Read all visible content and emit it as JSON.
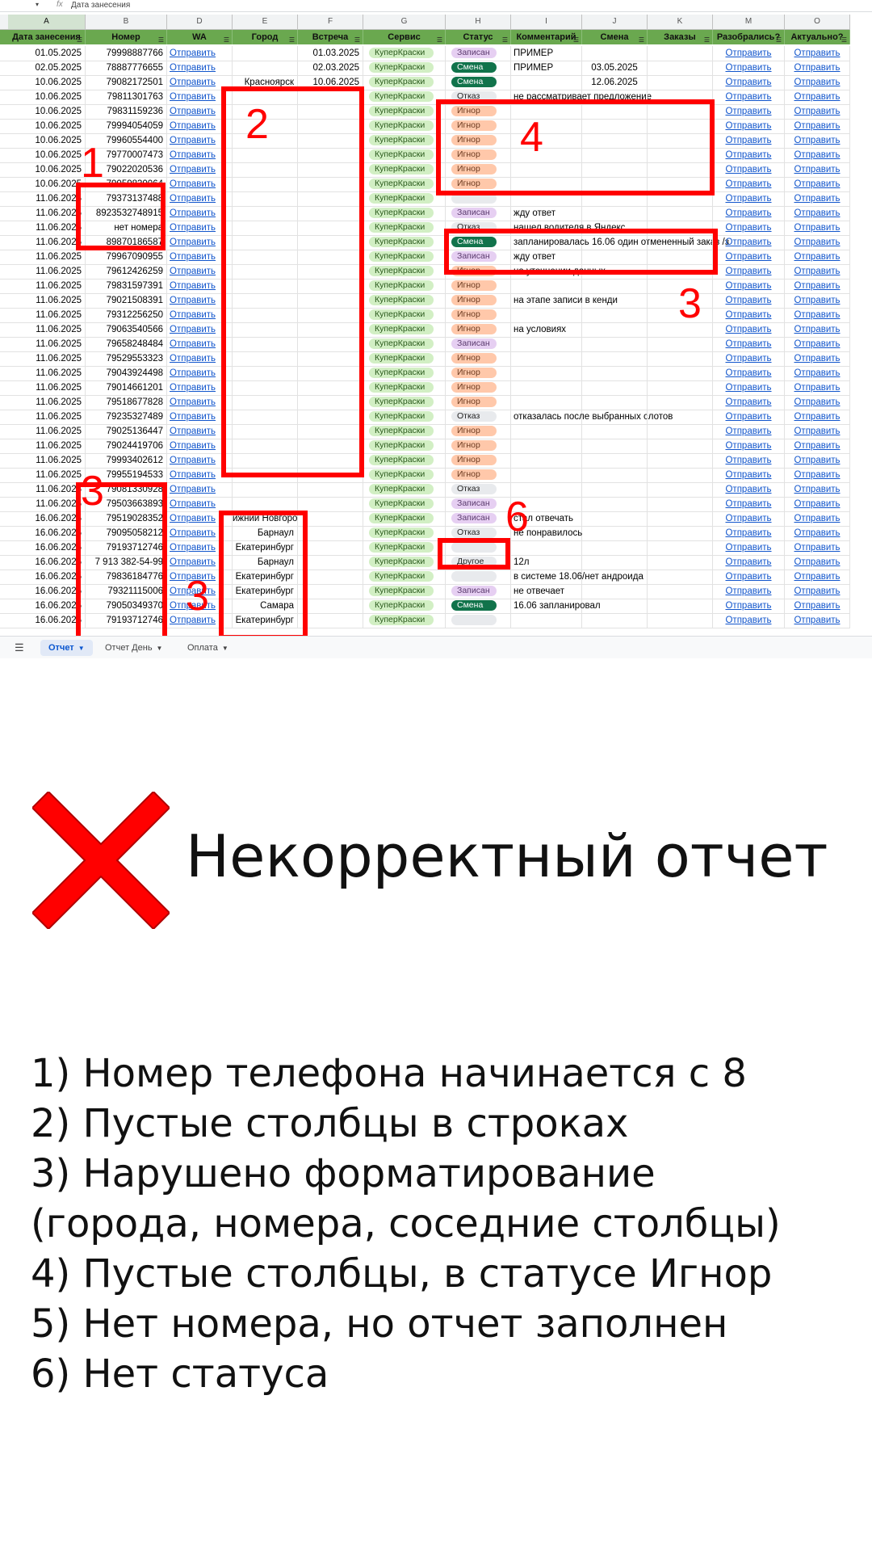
{
  "formula_bar": {
    "value": "Дата занесения"
  },
  "columns": [
    {
      "letter": "A",
      "header": "Дата занесения",
      "w": 96
    },
    {
      "letter": "B",
      "header": "Номер",
      "w": 101
    },
    {
      "letter": "D",
      "header": "WA",
      "w": 81
    },
    {
      "letter": "E",
      "header": "Город",
      "w": 81
    },
    {
      "letter": "F",
      "header": "Встреча",
      "w": 81
    },
    {
      "letter": "G",
      "header": "Сервис",
      "w": 102
    },
    {
      "letter": "H",
      "header": "Статус",
      "w": 81
    },
    {
      "letter": "I",
      "header": "Комментарий",
      "w": 88
    },
    {
      "letter": "J",
      "header": "Смена",
      "w": 81
    },
    {
      "letter": "K",
      "header": "Заказы",
      "w": 81
    },
    {
      "letter": "M",
      "header": "Разобрались?",
      "w": 89
    },
    {
      "letter": "O",
      "header": "Актуально?",
      "w": 81
    }
  ],
  "send_label": "Отправить",
  "rows": [
    {
      "date": "01.05.2025",
      "num": "79998887766",
      "city": "",
      "meet": "01.03.2025",
      "svc": "КуперКраски",
      "status": "Записан",
      "comment": "ПРИМЕР",
      "shift": ""
    },
    {
      "date": "02.05.2025",
      "num": "78887776655",
      "city": "",
      "meet": "02.03.2025",
      "svc": "КуперКраски",
      "status": "Смена",
      "comment": "ПРИМЕР",
      "shift": "03.05.2025"
    },
    {
      "date": "10.06.2025",
      "num": "79082172501",
      "city": "Красноярск",
      "meet": "10.06.2025",
      "svc": "КуперКраски",
      "status": "Смена",
      "comment": "",
      "shift": "12.06.2025"
    },
    {
      "date": "10.06.2025",
      "num": "79811301763",
      "city": "",
      "meet": "",
      "svc": "КуперКраски",
      "status": "Отказ",
      "comment": "не рассматривает предложение",
      "shift": ""
    },
    {
      "date": "10.06.2025",
      "num": "79831159236",
      "city": "",
      "meet": "",
      "svc": "КуперКраски",
      "status": "Игнор",
      "comment": "",
      "shift": ""
    },
    {
      "date": "10.06.2025",
      "num": "79994054059",
      "city": "",
      "meet": "",
      "svc": "КуперКраски",
      "status": "Игнор",
      "comment": "",
      "shift": ""
    },
    {
      "date": "10.06.2025",
      "num": "79960554400",
      "city": "",
      "meet": "",
      "svc": "КуперКраски",
      "status": "Игнор",
      "comment": "",
      "shift": ""
    },
    {
      "date": "10.06.2025",
      "num": "79770007473",
      "city": "",
      "meet": "",
      "svc": "КуперКраски",
      "status": "Игнор",
      "comment": "",
      "shift": ""
    },
    {
      "date": "10.06.2025",
      "num": "79022020536",
      "city": "",
      "meet": "",
      "svc": "КуперКраски",
      "status": "Игнор",
      "comment": "",
      "shift": ""
    },
    {
      "date": "10.06.2025",
      "num": "79059830064",
      "city": "",
      "meet": "",
      "svc": "КуперКраски",
      "status": "Игнор",
      "comment": "",
      "shift": ""
    },
    {
      "date": "11.06.2025",
      "num": "79373137488",
      "city": "",
      "meet": "",
      "svc": "КуперКраски",
      "status": "",
      "comment": "",
      "shift": ""
    },
    {
      "date": "11.06.2025",
      "num": "8923532748915",
      "city": "",
      "meet": "",
      "svc": "КуперКраски",
      "status": "Записан",
      "comment": "жду ответ",
      "shift": ""
    },
    {
      "date": "11.06.2025",
      "num": "нет номера",
      "city": "",
      "meet": "",
      "svc": "КуперКраски",
      "status": "Отказ",
      "comment": "нашел водителя в Яндекс",
      "shift": ""
    },
    {
      "date": "11.06.2025",
      "num": "89870186587",
      "city": "",
      "meet": "",
      "svc": "КуперКраски",
      "status": "Смена",
      "comment": "запланировалась 16.06 один отмененный заказ /з",
      "shift": ""
    },
    {
      "date": "11.06.2025",
      "num": "79967090955",
      "city": "",
      "meet": "",
      "svc": "КуперКраски",
      "status": "Записан",
      "comment": "жду ответ",
      "shift": ""
    },
    {
      "date": "11.06.2025",
      "num": "79612426259",
      "city": "",
      "meet": "",
      "svc": "КуперКраски",
      "status": "Игнор",
      "comment": "на уточнении данных",
      "shift": ""
    },
    {
      "date": "11.06.2025",
      "num": "79831597391",
      "city": "",
      "meet": "",
      "svc": "КуперКраски",
      "status": "Игнор",
      "comment": "",
      "shift": ""
    },
    {
      "date": "11.06.2025",
      "num": "79021508391",
      "city": "",
      "meet": "",
      "svc": "КуперКраски",
      "status": "Игнор",
      "comment": "на этапе записи в кенди",
      "shift": ""
    },
    {
      "date": "11.06.2025",
      "num": "79312256250",
      "city": "",
      "meet": "",
      "svc": "КуперКраски",
      "status": "Игнор",
      "comment": "",
      "shift": ""
    },
    {
      "date": "11.06.2025",
      "num": "79063540566",
      "city": "",
      "meet": "",
      "svc": "КуперКраски",
      "status": "Игнор",
      "comment": "на условиях",
      "shift": ""
    },
    {
      "date": "11.06.2025",
      "num": "79658248484",
      "city": "",
      "meet": "",
      "svc": "КуперКраски",
      "status": "Записан",
      "comment": "",
      "shift": ""
    },
    {
      "date": "11.06.2025",
      "num": "79529553323",
      "city": "",
      "meet": "",
      "svc": "КуперКраски",
      "status": "Игнор",
      "comment": "",
      "shift": ""
    },
    {
      "date": "11.06.2025",
      "num": "79043924498",
      "city": "",
      "meet": "",
      "svc": "КуперКраски",
      "status": "Игнор",
      "comment": "",
      "shift": ""
    },
    {
      "date": "11.06.2025",
      "num": "79014661201",
      "city": "",
      "meet": "",
      "svc": "КуперКраски",
      "status": "Игнор",
      "comment": "",
      "shift": ""
    },
    {
      "date": "11.06.2025",
      "num": "79518677828",
      "city": "",
      "meet": "",
      "svc": "КуперКраски",
      "status": "Игнор",
      "comment": "",
      "shift": ""
    },
    {
      "date": "11.06.2025",
      "num": "79235327489",
      "city": "",
      "meet": "",
      "svc": "КуперКраски",
      "status": "Отказ",
      "comment": "отказалась после выбранных слотов",
      "shift": ""
    },
    {
      "date": "11.06.2025",
      "num": "79025136447",
      "city": "",
      "meet": "",
      "svc": "КуперКраски",
      "status": "Игнор",
      "comment": "",
      "shift": ""
    },
    {
      "date": "11.06.2025",
      "num": "79024419706",
      "city": "",
      "meet": "",
      "svc": "КуперКраски",
      "status": "Игнор",
      "comment": "",
      "shift": ""
    },
    {
      "date": "11.06.2025",
      "num": "79993402612",
      "city": "",
      "meet": "",
      "svc": "КуперКраски",
      "status": "Игнор",
      "comment": "",
      "shift": ""
    },
    {
      "date": "11.06.2025",
      "num": "79955194533",
      "city": "",
      "meet": "",
      "svc": "КуперКраски",
      "status": "Игнор",
      "comment": "",
      "shift": ""
    },
    {
      "date": "11.06.2025",
      "num": "79081330928",
      "city": "",
      "meet": "",
      "svc": "КуперКраски",
      "status": "Отказ",
      "comment": "",
      "shift": ""
    },
    {
      "date": "11.06.2025",
      "num": "79503663893",
      "city": "",
      "meet": "",
      "svc": "КуперКраски",
      "status": "Записан",
      "comment": "",
      "shift": ""
    },
    {
      "date": "16.06.2025",
      "num": "79519028352",
      "city": "ижний Новгород",
      "meet": "",
      "svc": "КуперКраски",
      "status": "Записан",
      "comment": "стал отвечать",
      "shift": ""
    },
    {
      "date": "16.06.2025",
      "num": "79095058212",
      "city": "Барнаул",
      "meet": "",
      "svc": "КуперКраски",
      "status": "Отказ",
      "comment": "не понравилось",
      "shift": ""
    },
    {
      "date": "16.06.2025",
      "num": "79193712746",
      "city": "Екатеринбург",
      "meet": "",
      "svc": "КуперКраски",
      "status": "",
      "comment": "",
      "shift": ""
    },
    {
      "date": "16.06.2025",
      "num": "7 913 382-54-99",
      "city": "Барнаул",
      "meet": "",
      "svc": "КуперКраски",
      "status": "Другое",
      "comment": "12л",
      "shift": ""
    },
    {
      "date": "16.06.2025",
      "num": "79836184776",
      "city": "Екатеринбург",
      "meet": "",
      "svc": "КуперКраски",
      "status": "",
      "comment": "в системе 18.06/нет андроида",
      "shift": ""
    },
    {
      "date": "16.06.2025",
      "num": "79321115006",
      "city": "Екатеринбург",
      "meet": "",
      "svc": "КуперКраски",
      "status": "Записан",
      "comment": "не отвечает",
      "shift": ""
    },
    {
      "date": "16.06.2025",
      "num": "79050349370",
      "city": "Самара",
      "meet": "",
      "svc": "КуперКраски",
      "status": "Смена",
      "comment": "16.06 запланировал",
      "shift": ""
    },
    {
      "date": "16.06.2025",
      "num": "79193712746",
      "city": "Екатеринбург",
      "meet": "",
      "svc": "КуперКраски",
      "status": "",
      "comment": "",
      "shift": ""
    }
  ],
  "tabs": [
    {
      "label": "Отчет",
      "active": true
    },
    {
      "label": "Отчет День",
      "active": false
    },
    {
      "label": "Оплата",
      "active": false
    }
  ],
  "markers": [
    "1",
    "2",
    "3",
    "4",
    "3",
    "3",
    "6"
  ],
  "colors": {
    "annotation": "#ff0000",
    "header_green": "#6aa84f",
    "link": "#1155cc"
  },
  "verdict_title": "Некорректный отчет",
  "issues": [
    "1) Номер телефона начинается с 8",
    "2) Пустые столбцы в строках",
    "3) Нарушено форматирование",
    "(города, номера, соседние столбцы)",
    "4) Пустые столбцы, в статусе Игнор",
    "5) Нет номера, но отчет заполнен",
    "6) Нет статуса"
  ]
}
